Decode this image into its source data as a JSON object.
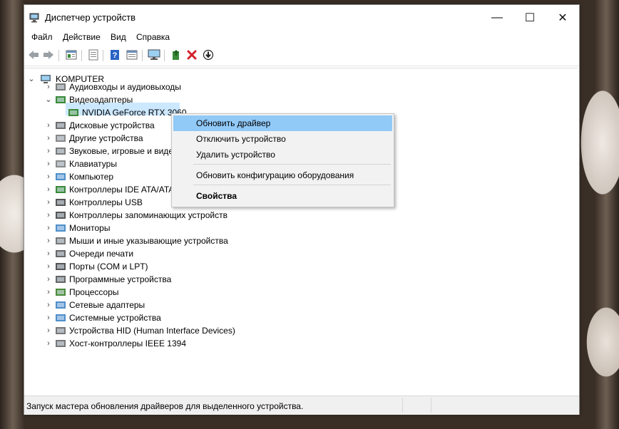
{
  "window": {
    "title": "Диспетчер устройств",
    "controls": {
      "minimize": "—",
      "maximize": "☐",
      "close": "✕"
    }
  },
  "menu": [
    "Файл",
    "Действие",
    "Вид",
    "Справка"
  ],
  "toolbar": {
    "icons": [
      "back-arrow-icon",
      "forward-arrow-icon",
      "properties-icon",
      "list-view-icon",
      "help-icon",
      "details-icon",
      "monitor-scan-icon",
      "add-driver-icon",
      "uninstall-icon",
      "update-driver-icon"
    ]
  },
  "tree": {
    "root": "KOMPUTER",
    "items": [
      {
        "label": "Аудиовходы и аудиовыходы",
        "icon": "speaker-icon",
        "expanded": false
      },
      {
        "label": "Видеоадаптеры",
        "icon": "display-adapter-icon",
        "expanded": true
      },
      {
        "label": "NVIDIA GeForce RTX 3060",
        "icon": "display-adapter-icon",
        "child": true,
        "selected": true
      },
      {
        "label": "Дисковые устройства",
        "icon": "disk-drive-icon",
        "expanded": false
      },
      {
        "label": "Другие устройства",
        "icon": "unknown-device-icon",
        "expanded": false
      },
      {
        "label": "Звуковые, игровые и виде",
        "icon": "sound-icon",
        "expanded": false
      },
      {
        "label": "Клавиатуры",
        "icon": "keyboard-icon",
        "expanded": false
      },
      {
        "label": "Компьютер",
        "icon": "computer-icon",
        "expanded": false
      },
      {
        "label": "Контроллеры IDE ATA/ATA",
        "icon": "ide-controller-icon",
        "expanded": false
      },
      {
        "label": "Контроллеры USB",
        "icon": "usb-icon",
        "expanded": false
      },
      {
        "label": "Контроллеры запоминающих устройств",
        "icon": "storage-controller-icon",
        "expanded": false
      },
      {
        "label": "Мониторы",
        "icon": "monitor-icon",
        "expanded": false
      },
      {
        "label": "Мыши и иные указывающие устройства",
        "icon": "mouse-icon",
        "expanded": false
      },
      {
        "label": "Очереди печати",
        "icon": "printer-icon",
        "expanded": false
      },
      {
        "label": "Порты (COM и LPT)",
        "icon": "port-icon",
        "expanded": false
      },
      {
        "label": "Программные устройства",
        "icon": "software-device-icon",
        "expanded": false
      },
      {
        "label": "Процессоры",
        "icon": "processor-icon",
        "expanded": false
      },
      {
        "label": "Сетевые адаптеры",
        "icon": "network-adapter-icon",
        "expanded": false
      },
      {
        "label": "Системные устройства",
        "icon": "system-device-icon",
        "expanded": false
      },
      {
        "label": "Устройства HID (Human Interface Devices)",
        "icon": "hid-icon",
        "expanded": false
      },
      {
        "label": "Хост-контроллеры IEEE 1394",
        "icon": "ieee1394-icon",
        "expanded": false
      }
    ]
  },
  "context_menu": {
    "update_driver": "Обновить драйвер",
    "disable_device": "Отключить устройство",
    "uninstall_device": "Удалить устройство",
    "scan_hardware": "Обновить конфигурацию оборудования",
    "properties": "Свойства"
  },
  "status": {
    "text": "Запуск мастера обновления драйверов для выделенного устройства."
  },
  "colors": {
    "selection": "#cce8ff",
    "menu_highlight": "#91c9f7",
    "close_red": "#d4202a",
    "help_blue": "#2b63c6"
  }
}
